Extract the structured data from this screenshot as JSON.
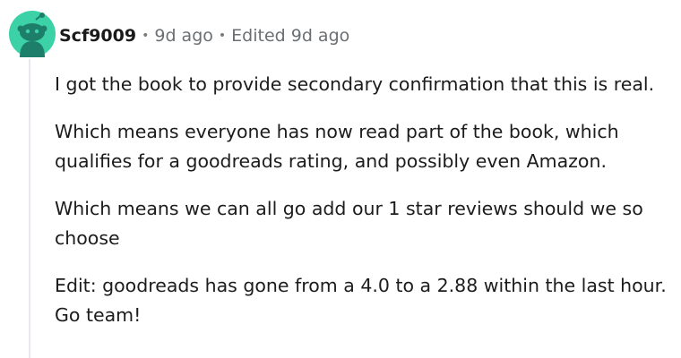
{
  "comment": {
    "author": "Scf9009",
    "separator": "•",
    "posted": "9d ago",
    "edited": "Edited 9d ago",
    "paragraphs": [
      "I got the book to provide secondary confirmation that this is real.",
      "Which means everyone has now read part of the book, which qualifies for a goodreads rating, and possibly even Amazon.",
      "Which means we can all go add our 1 star reviews should we so choose",
      "Edit: goodreads has gone from a 4.0 to a 2.88 within the last hour. Go team!"
    ]
  },
  "avatar": {
    "icon": "snoo-avatar-icon",
    "bg_color": "#3cd1a6",
    "fg_color": "#1d7f6a"
  }
}
